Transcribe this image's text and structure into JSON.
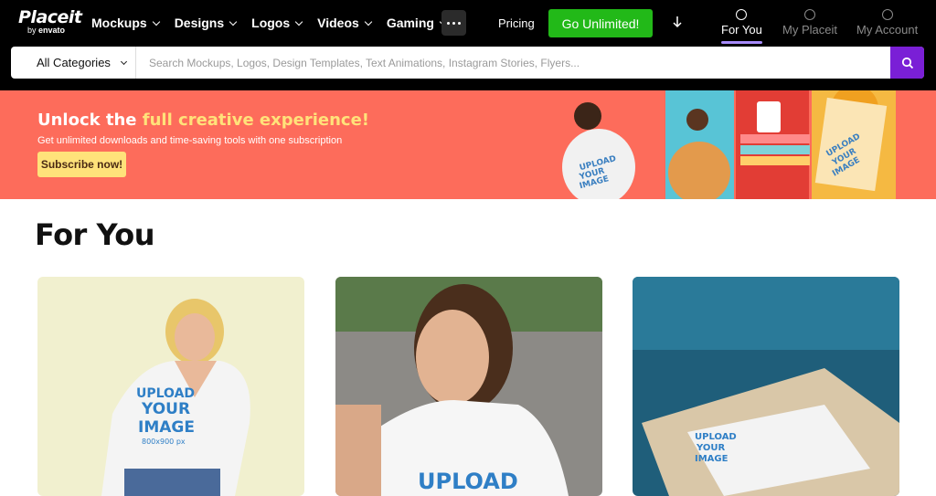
{
  "logo": {
    "main": "Placeit",
    "by": "by",
    "brand": "envato"
  },
  "nav": {
    "items": [
      {
        "label": "Mockups"
      },
      {
        "label": "Designs"
      },
      {
        "label": "Logos"
      },
      {
        "label": "Videos"
      },
      {
        "label": "Gaming"
      }
    ],
    "pricing": "Pricing",
    "cta": "Go Unlimited!",
    "tabs": [
      {
        "label": "For You",
        "active": true
      },
      {
        "label": "My Placeit",
        "active": false
      },
      {
        "label": "My Account",
        "active": false
      }
    ]
  },
  "search": {
    "category": "All Categories",
    "placeholder": "Search Mockups, Logos, Design Templates, Text Animations, Instagram Stories, Flyers..."
  },
  "banner": {
    "head_prefix": "Unlock the ",
    "head_highlight": "full creative experience!",
    "subtitle": "Get unlimited downloads and time-saving tools with one subscription",
    "cta": "Subscribe now!",
    "promo_text": "UPLOAD YOUR IMAGE"
  },
  "page": {
    "title": "For You"
  },
  "cards": [
    {
      "text_line1": "UPLOAD",
      "text_line2": "YOUR",
      "text_line3": "IMAGE",
      "text_line4": "800x900 px"
    },
    {
      "text_line1": "UPLOAD"
    },
    {
      "text_line1": "UPLOAD",
      "text_line2": "YOUR",
      "text_line3": "IMAGE"
    }
  ],
  "colors": {
    "accent": "#7a1fd6",
    "cta_green": "#22b918",
    "banner": "#fd6c5b",
    "highlight": "#ffe27a"
  }
}
